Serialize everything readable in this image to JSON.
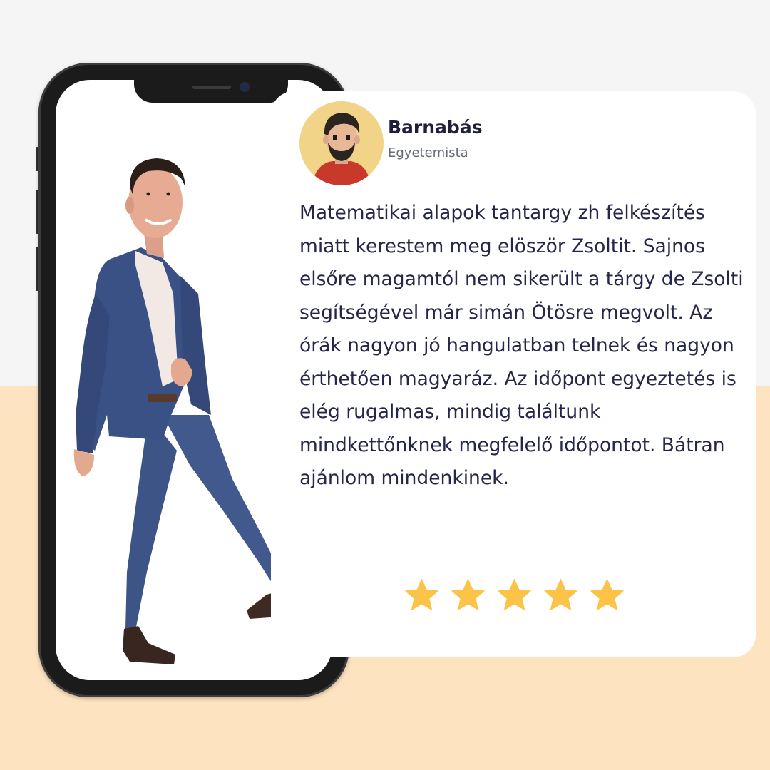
{
  "testimonial": {
    "name": "Barnabás",
    "role": "Egyetemista",
    "text": "Matematikai alapok tantargy zh felkészítés miatt kerestem meg elöször Zsoltit. Sajnos elsőre magamtól nem sikerült a tárgy de Zsolti segítségével már simán Ötösre megvolt. Az órák nagyon jó hangulatban telnek és nagyon érthetően magyaráz. Az időpont egyeztetés is elég rugalmas, mindig találtunk mindkettőnknek megfelelő időpontot. Bátran ajánlom mindenkinek.",
    "rating": 5,
    "rating_max": 5
  },
  "colors": {
    "background_top": "#f5f5f5",
    "background_bottom": "#fde3bf",
    "card": "#ffffff",
    "star": "#fbc348",
    "avatar_bg": "#f2d488",
    "text": "#26264a"
  },
  "icons": {
    "avatar": "man-avatar-icon",
    "rating": "star-icon"
  }
}
